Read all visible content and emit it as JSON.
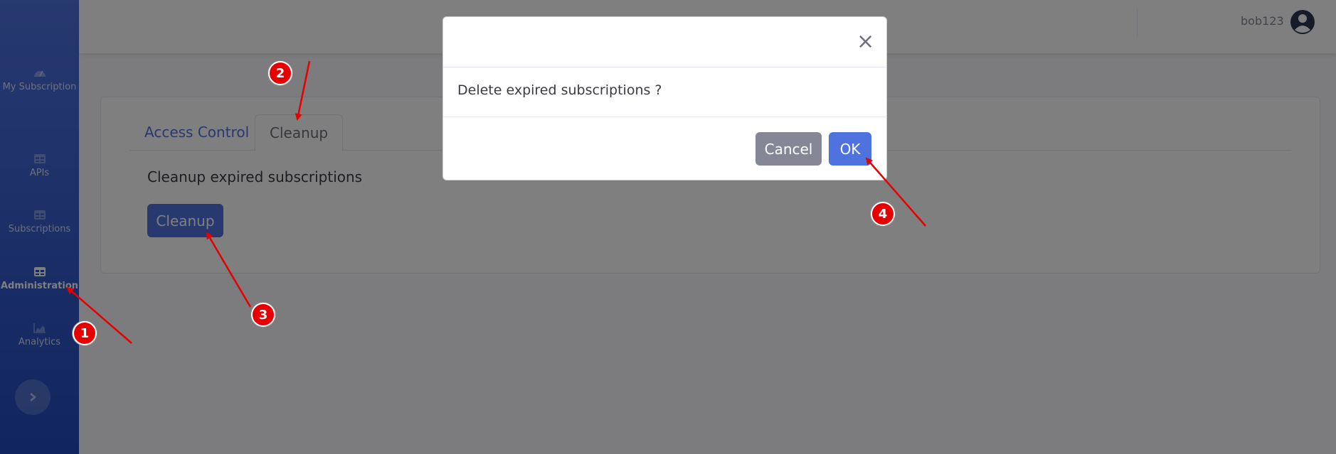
{
  "sidebar": {
    "items": [
      {
        "label": "My Subscription",
        "icon": "gauge-icon"
      },
      {
        "label": "APIs",
        "icon": "table-icon"
      },
      {
        "label": "Subscriptions",
        "icon": "table-icon"
      },
      {
        "label": "Administration",
        "icon": "table-icon"
      },
      {
        "label": "Analytics",
        "icon": "chart-area-icon"
      }
    ],
    "toggle_icon": "chevron-right-icon"
  },
  "topbar": {
    "username": "bob123",
    "avatar_icon": "user-circle-icon"
  },
  "main": {
    "tabs": [
      {
        "label": "Access Control"
      },
      {
        "label": "Cleanup"
      }
    ],
    "section_title": "Cleanup expired subscriptions",
    "cleanup_button": "Cleanup"
  },
  "modal": {
    "close_symbol": "×",
    "message": "Delete expired subscriptions ?",
    "cancel_label": "Cancel",
    "ok_label": "OK"
  },
  "annotations": {
    "badges": [
      "1",
      "2",
      "3",
      "4"
    ],
    "color": "#e60000"
  },
  "colors": {
    "primary": "#4e73df",
    "secondary": "#858796",
    "sidebar_gradient_end": "#224abe"
  }
}
